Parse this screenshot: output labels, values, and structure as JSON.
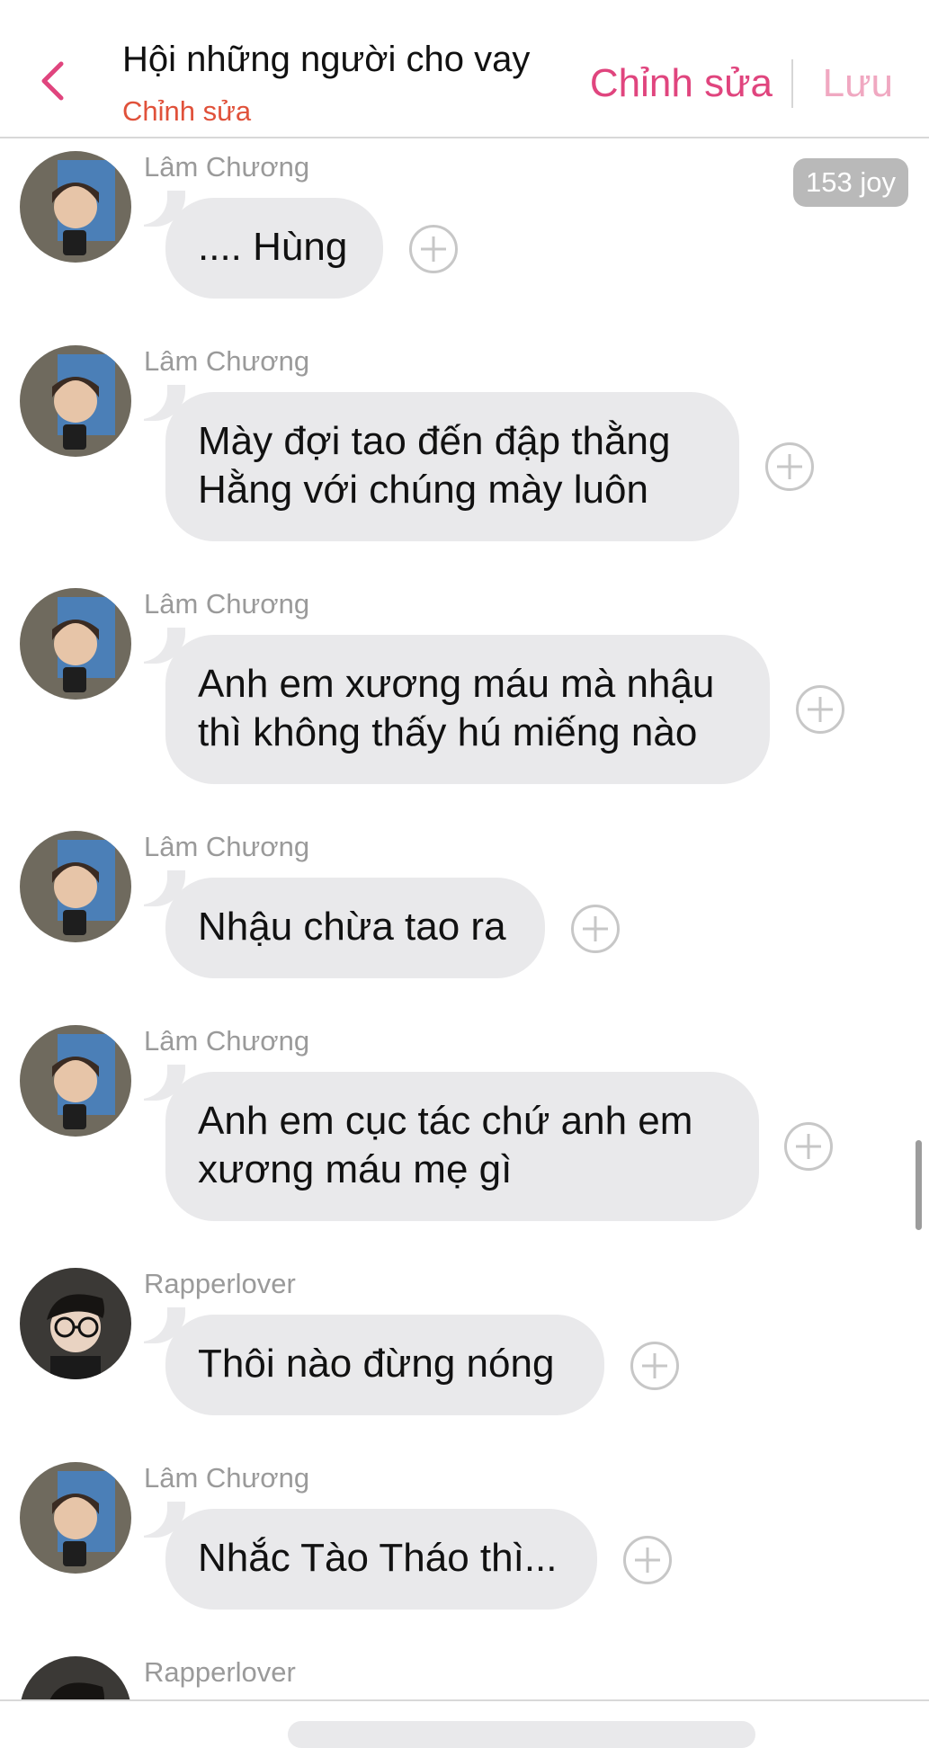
{
  "header": {
    "title": "Hội những người cho vay",
    "subtitle": "Chỉnh sửa",
    "edit_label": "Chỉnh sửa",
    "save_label": "Lưu"
  },
  "joy_badge": "153 joy",
  "colors": {
    "accent": "#e0457e",
    "subtitle": "#e0513a",
    "bubble": "#e9e9eb",
    "sender": "#9a9a9a"
  },
  "messages": [
    {
      "sender": "Lâm Chương",
      "text": ".... Hùng"
    },
    {
      "sender": "Lâm Chương",
      "text": "Mày đợi tao đến đập thằng Hằng với chúng mày luôn"
    },
    {
      "sender": "Lâm Chương",
      "text": "Anh em xương máu mà nhậu thì không thấy hú miếng nào"
    },
    {
      "sender": "Lâm Chương",
      "text": "Nhậu chừa tao ra"
    },
    {
      "sender": "Lâm Chương",
      "text": "Anh em cục tác chứ anh em xương máu mẹ gì"
    },
    {
      "sender": "Rapperlover",
      "text": "Thôi nào đừng nóng"
    },
    {
      "sender": "Lâm Chương",
      "text": "Nhắc Tào Tháo thì..."
    },
    {
      "sender": "Rapperlover",
      "text": ""
    }
  ]
}
